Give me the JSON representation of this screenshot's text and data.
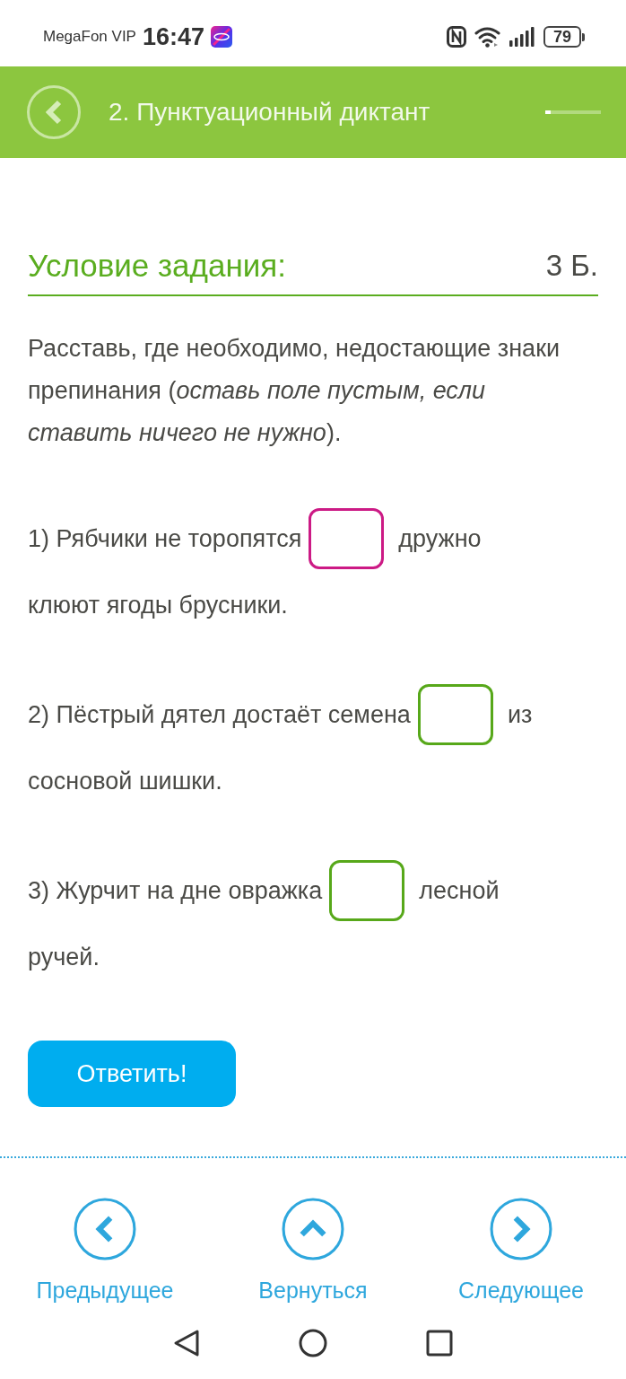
{
  "status_bar": {
    "carrier": "MegaFon VIP",
    "time": "16:47",
    "battery": "79"
  },
  "header": {
    "title": "2. Пунктуационный диктант",
    "progress": {
      "level": 0.1
    }
  },
  "task": {
    "heading": "Условие задания:",
    "points": "3 Б.",
    "instruction": "Расставь, где необходимо, недостающие знаки препинания (*оставь поле пустым, если ставить ничего не нужно*).",
    "items": [
      {
        "text_before": "1) Рябчики не торопятся",
        "text_after": "дружно",
        "text_next_line": "клюют ягоды брусники.",
        "selected": true
      },
      {
        "text_before": "2) Пёстрый дятел достаёт семена",
        "text_after": "из",
        "text_next_line": "сосновой шишки.",
        "selected": false
      },
      {
        "text_before": "3) Журчит на дне овражка",
        "text_after": "лесной",
        "text_next_line": "ручей.",
        "selected": false
      }
    ]
  },
  "submit_button": {
    "label": "Ответить!"
  },
  "navigation": [
    {
      "kind": "previous",
      "label": "Предыдущее"
    },
    {
      "kind": "up",
      "label": "Вернуться"
    },
    {
      "kind": "next",
      "label": "Следующее"
    }
  ]
}
